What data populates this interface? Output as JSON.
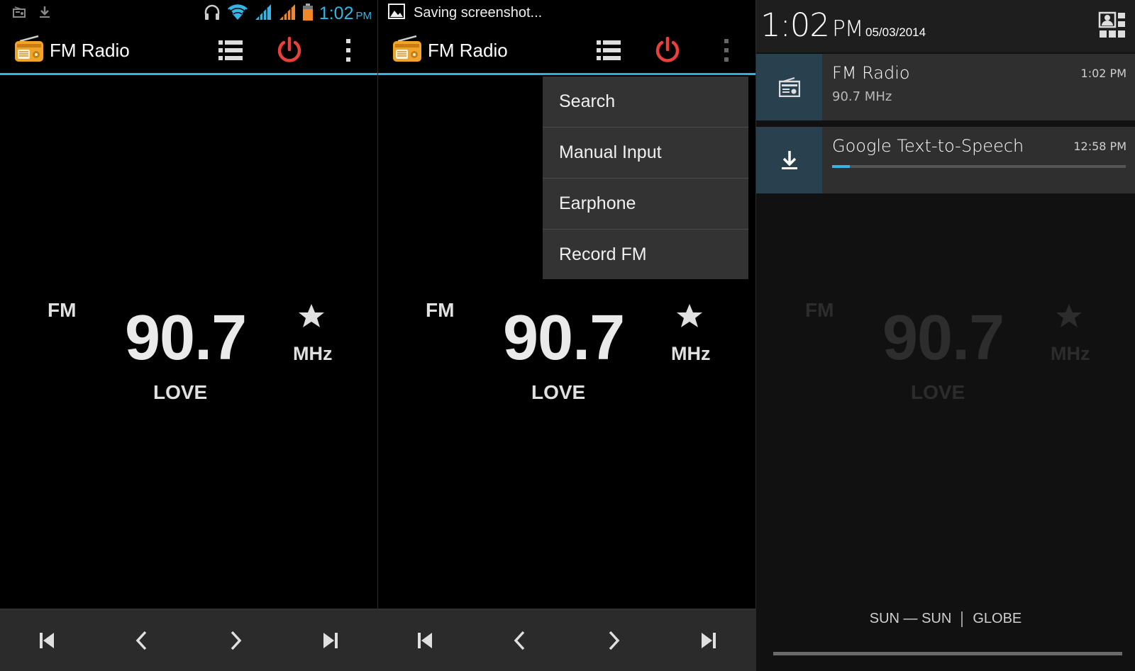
{
  "colors": {
    "accent": "#33b5e5",
    "power": "#e8403a",
    "menu_bg": "#333333",
    "bottom_bar": "#2b2b2b",
    "notif_icon_bg": "#29414f"
  },
  "app": {
    "title": "FM Radio",
    "logo_icon": "radio-icon"
  },
  "status_bar": {
    "time": "1:02",
    "ampm": "PM",
    "left_icons": [
      "radio-notification-icon",
      "download-icon"
    ],
    "right_icons": [
      "headset-icon",
      "wifi-icon",
      "signal-icon",
      "signal-icon",
      "battery-icon"
    ],
    "saving_text": "Saving screenshot..."
  },
  "action_bar": {
    "buttons": [
      "channel-list-icon",
      "power-icon",
      "overflow-menu-icon"
    ]
  },
  "tuner": {
    "band": "FM",
    "frequency": "90.7",
    "unit": "MHz",
    "station": "LOVE",
    "favorite_icon": "star-icon"
  },
  "bottom_nav": {
    "buttons": [
      "skip-previous-icon",
      "seek-back-icon",
      "seek-forward-icon",
      "skip-next-icon"
    ]
  },
  "overflow_menu": {
    "items": [
      {
        "label": "Search"
      },
      {
        "label": "Manual Input"
      },
      {
        "label": "Earphone"
      },
      {
        "label": "Record FM"
      }
    ]
  },
  "shade": {
    "time": "1:02",
    "ampm": "PM",
    "date": "05/03/2014",
    "notifications": [
      {
        "title": "FM Radio",
        "subtitle": "90.7 MHz",
        "time": "1:02 PM",
        "icon": "radio-icon"
      },
      {
        "title": "Google Text-to-Speech",
        "time": "12:58 PM",
        "icon": "download-icon",
        "progress": 0.06
      }
    ],
    "carrier_left": "SUN — SUN",
    "carrier_right": "GLOBE"
  }
}
